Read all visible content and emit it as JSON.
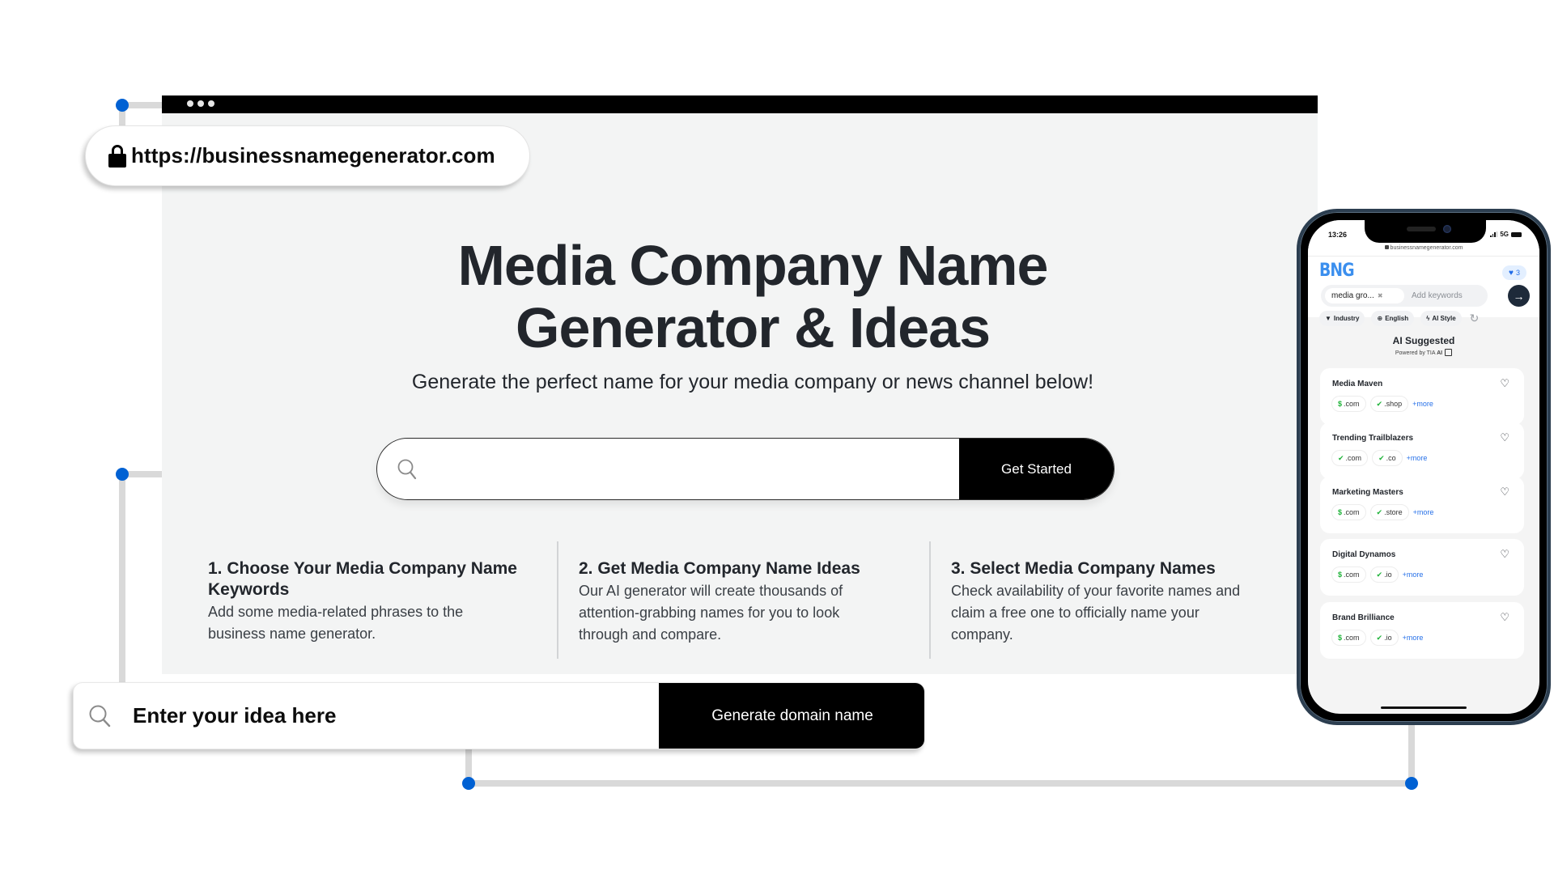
{
  "colors": {
    "accent_dot": "#0061d3",
    "connector": "#d9d9d9",
    "page_bg": "#f3f4f4",
    "button_bg": "#000000",
    "text_dark": "#22262c",
    "bng_blue": "#3b8fee",
    "available_green": "#20b33a",
    "more_link_blue": "#2670e8"
  },
  "browser": {
    "address": "https://businessnamegenerator.com",
    "window_dots_icon": "three-dots"
  },
  "hero": {
    "title_line1": "Media Company Name",
    "title_line2": "Generator & Ideas",
    "subtitle": "Generate the perfect name for your media company or news channel below!",
    "search_placeholder": "",
    "search_value": "",
    "cta_label": "Get Started"
  },
  "steps": [
    {
      "title_line1": "1. Choose Your Media Company Name",
      "title_line2": "Keywords",
      "desc_line1": "Add some media-related phrases to the",
      "desc_line2": "business name generator."
    },
    {
      "title": "2. Get Media Company Name Ideas",
      "desc_line1": "Our AI generator will create thousands of",
      "desc_line2": "attention-grabbing names for you to look",
      "desc_line3": "through and compare."
    },
    {
      "title": "3. Select Media Company Names",
      "desc_line1": "Check availability of your favorite names and",
      "desc_line2": "claim a free one to officially name your",
      "desc_line3": "company."
    }
  ],
  "bottom_bar": {
    "idea_text": "Enter your idea here",
    "button_label": "Generate domain name"
  },
  "phone": {
    "status_time": "13:26",
    "network": "5G",
    "url": "businessnamegenerator.com",
    "logo": "BNG",
    "favorites_count": "3",
    "keyword_chip": "media gro...",
    "keyword_placeholder": "Add keywords",
    "go_arrow": "→",
    "filters": [
      {
        "icon": "▼",
        "label": "Industry"
      },
      {
        "icon": "⊕",
        "label": "English"
      },
      {
        "icon": "ϟ",
        "label": "AI Style"
      }
    ],
    "refresh_icon": "↻",
    "section_title": "AI Suggested",
    "powered_by": "Powered by TIA",
    "powered_by_bold": "AI",
    "names": [
      {
        "name": "Media Maven",
        "tlds": [
          {
            "mark": "$",
            "tld": ".com"
          },
          {
            "mark": "✔",
            "tld": ".shop"
          }
        ],
        "more": "+more"
      },
      {
        "name": "Trending Trailblazers",
        "tlds": [
          {
            "mark": "✔",
            "tld": ".com"
          },
          {
            "mark": "✔",
            "tld": ".co"
          }
        ],
        "more": "+more"
      },
      {
        "name": "Marketing Masters",
        "tlds": [
          {
            "mark": "$",
            "tld": ".com"
          },
          {
            "mark": "✔",
            "tld": ".store"
          }
        ],
        "more": "+more"
      },
      {
        "name": "Digital Dynamos",
        "tlds": [
          {
            "mark": "$",
            "tld": ".com"
          },
          {
            "mark": "✔",
            "tld": ".io"
          }
        ],
        "more": "+more"
      },
      {
        "name": "Brand Brilliance",
        "tlds": [
          {
            "mark": "$",
            "tld": ".com"
          },
          {
            "mark": "✔",
            "tld": ".io"
          }
        ],
        "more": "+more"
      }
    ]
  }
}
